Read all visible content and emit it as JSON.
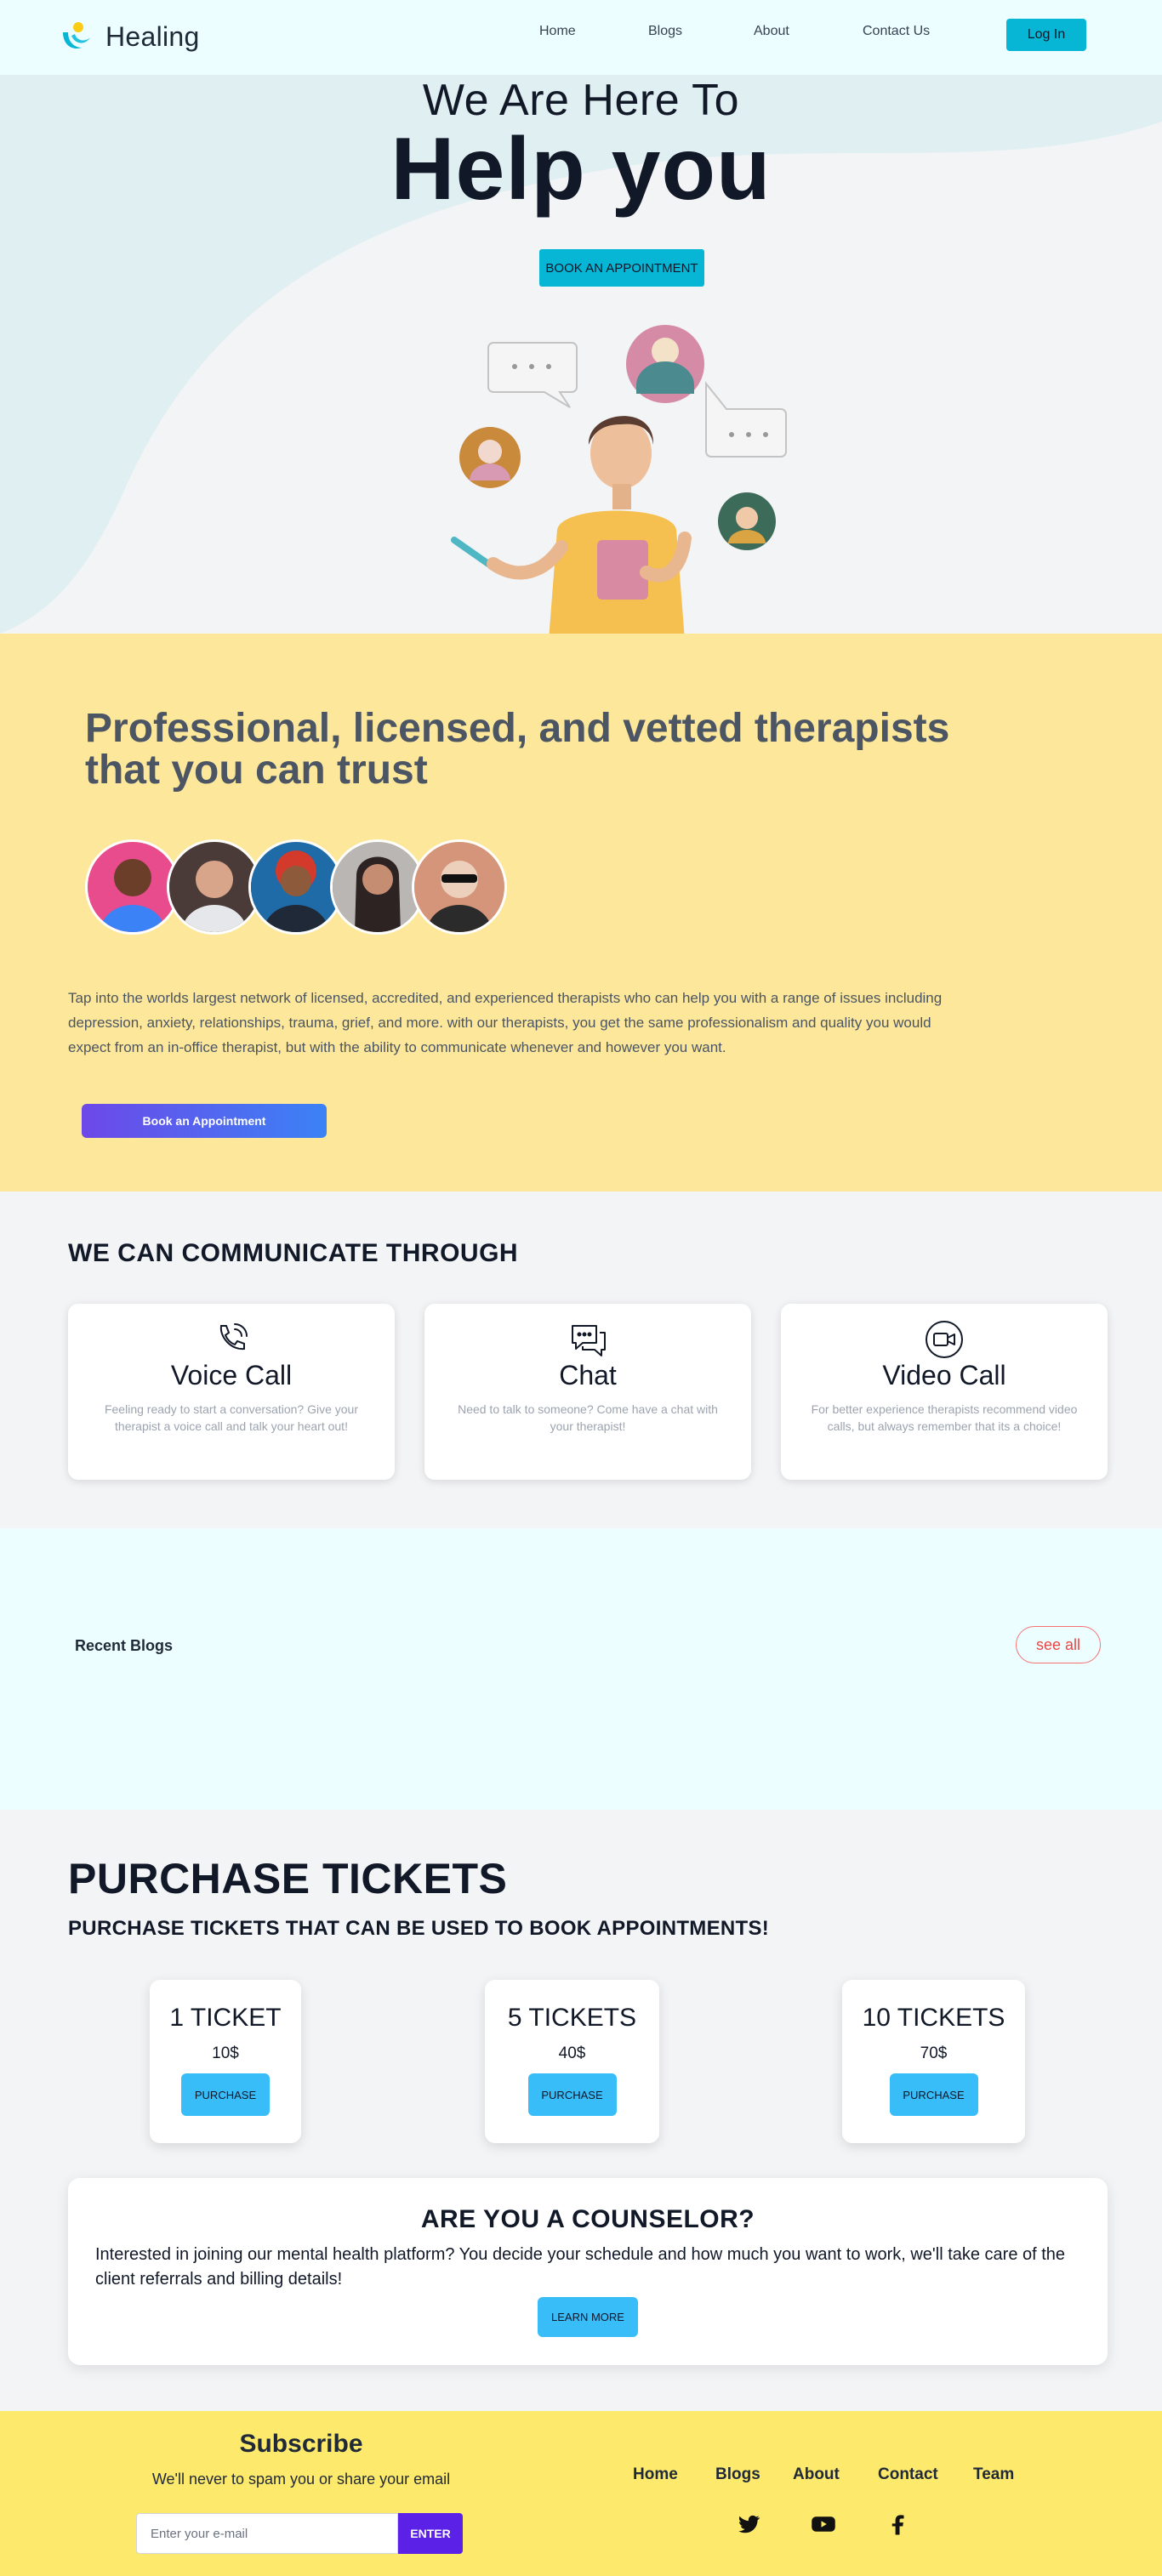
{
  "nav": {
    "brand": "Healing",
    "links": [
      "Home",
      "Blogs",
      "About",
      "Contact Us"
    ],
    "login": "Log In"
  },
  "hero": {
    "line1": "We Are Here To",
    "line2": "Help you",
    "cta": "BOOK AN APPOINTMENT"
  },
  "therapists": {
    "title": "Professional, licensed, and vetted therapists that you can trust",
    "description": "Tap into the worlds largest network of licensed, accredited, and experienced therapists who can help you with a range of issues including depression, anxiety, relationships, trauma, grief, and more. with our therapists, you get the same professionalism and quality you would expect from an in-office therapist, but with the ability to communicate whenever and however you want.",
    "cta": "Book an Appointment",
    "avatar_count": 5
  },
  "communicate": {
    "heading": "WE CAN COMMUNICATE THROUGH",
    "cards": [
      {
        "icon": "phone-call-icon",
        "title": "Voice Call",
        "text": "Feeling ready to start a conversation? Give your therapist a voice call and talk your heart out!"
      },
      {
        "icon": "chat-icon",
        "title": "Chat",
        "text": "Need to talk to someone? Come have a chat with your therapist!"
      },
      {
        "icon": "video-camera-icon",
        "title": "Video Call",
        "text": "For better experience therapists recommend video calls, but always remember that its a choice!"
      }
    ]
  },
  "blogs": {
    "title": "Recent Blogs",
    "see_all": "see all"
  },
  "tickets": {
    "heading": "PURCHASE TICKETS",
    "subheading": "PURCHASE TICKETS THAT CAN BE USED TO BOOK APPOINTMENTS!",
    "items": [
      {
        "name": "1 TICKET",
        "price": "10$",
        "button": "PURCHASE"
      },
      {
        "name": "5 TICKETS",
        "price": "40$",
        "button": "PURCHASE"
      },
      {
        "name": "10 TICKETS",
        "price": "70$",
        "button": "PURCHASE"
      }
    ]
  },
  "counselor": {
    "title": "ARE YOU A COUNSELOR?",
    "text": "Interested in joining our mental health platform? You decide your schedule and how much you want to work, we'll take care of the client referrals and billing details!",
    "button": "LEARN MORE"
  },
  "footer": {
    "subscribe_title": "Subscribe",
    "subscribe_text": "We'll never to spam you or share your email",
    "email_placeholder": "Enter your e-mail",
    "enter": "ENTER",
    "links": [
      "Home",
      "Blogs",
      "About",
      "Contact",
      "Team"
    ],
    "social": [
      "twitter-icon",
      "youtube-icon",
      "facebook-icon"
    ]
  },
  "colors": {
    "accent": "#06b6d4",
    "hero_bg": "#f3f4f6",
    "wave": "#e0eff2",
    "therapists_bg": "#fde79a",
    "blogs_bg": "#ecfeff",
    "ticket_button": "#38bdf8",
    "footer_bg": "#fde96b",
    "enter_button": "#5b21e6"
  }
}
